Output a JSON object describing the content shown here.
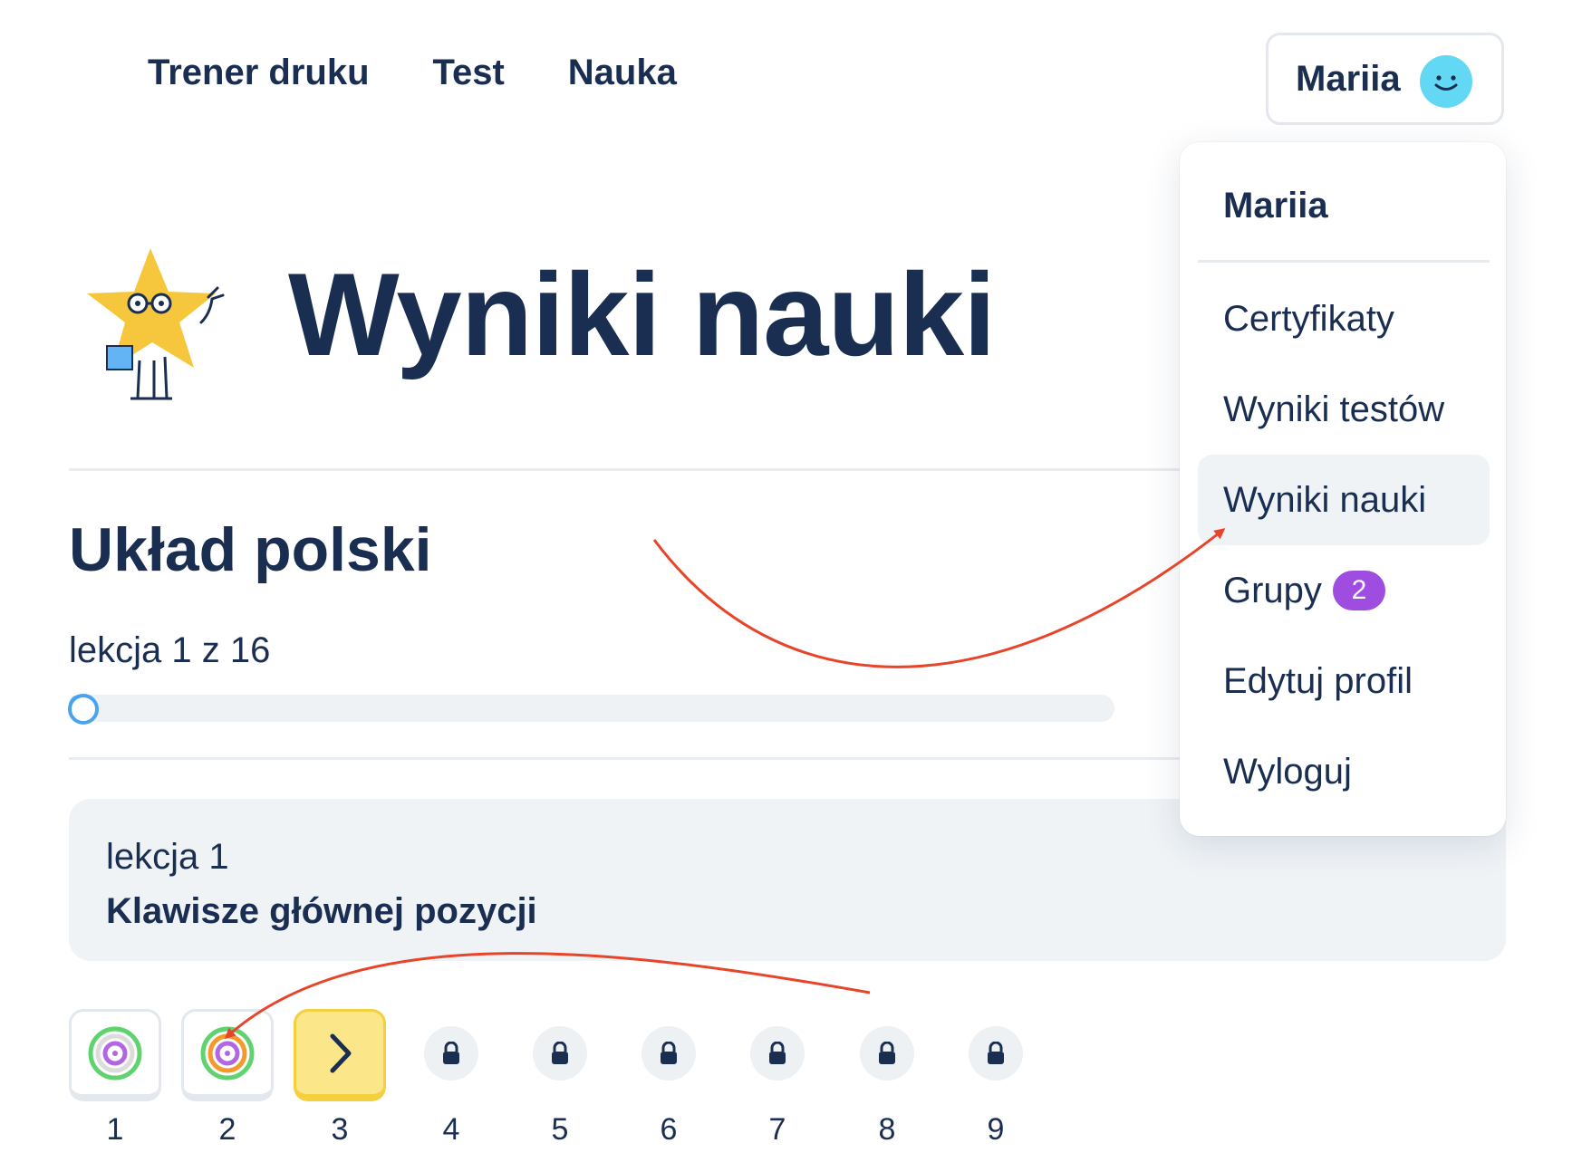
{
  "nav": {
    "items": [
      "Trener druku",
      "Test",
      "Nauka"
    ]
  },
  "user": {
    "name": "Mariia"
  },
  "hero": {
    "title": "Wyniki nauki"
  },
  "course": {
    "title": "Układ polski",
    "lesson_count": "lekcja 1 z 16",
    "progress": 0.02
  },
  "lesson": {
    "number": "lekcja 1",
    "name": "Klawisze głównej pozycji"
  },
  "exercises": [
    {
      "label": "1",
      "state": "done"
    },
    {
      "label": "2",
      "state": "done"
    },
    {
      "label": "3",
      "state": "current"
    },
    {
      "label": "4",
      "state": "locked"
    },
    {
      "label": "5",
      "state": "locked"
    },
    {
      "label": "6",
      "state": "locked"
    },
    {
      "label": "7",
      "state": "locked"
    },
    {
      "label": "8",
      "state": "locked"
    },
    {
      "label": "9",
      "state": "locked"
    }
  ],
  "dropdown": {
    "name": "Mariia",
    "items": [
      "Certyfikaty",
      "Wyniki testów",
      "Wyniki nauki",
      "Grupy",
      "Edytuj profil",
      "Wyloguj"
    ],
    "active": "Wyniki nauki",
    "groups_badge": "2"
  },
  "colors": {
    "text": "#1a2e52",
    "accent_yellow": "#fce68a",
    "badge_purple": "#9e4de0",
    "avatar": "#63d8f4",
    "annotation_arrow": "#e8442a"
  }
}
